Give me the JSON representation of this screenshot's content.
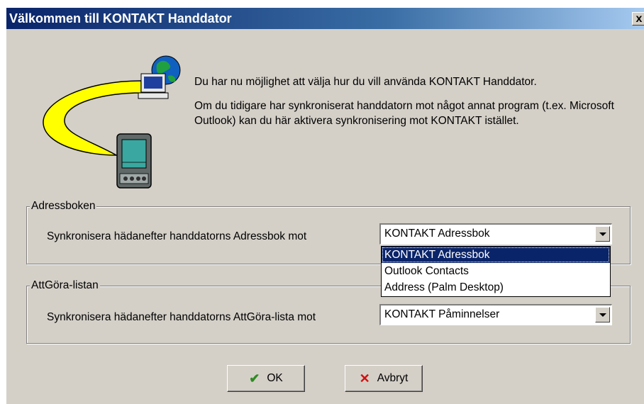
{
  "window": {
    "title": "Välkommen till KONTAKT Handdator",
    "close_label": "x"
  },
  "intro": {
    "line1": "Du har nu möjlighet att välja hur du vill använda KONTAKT Handdator.",
    "line2": "Om du tidigare har synkroniserat handdatorn mot något annat program (t.ex. Microsoft Outlook) kan du här aktivera synkronisering mot KONTAKT istället."
  },
  "address_group": {
    "legend": "Adressboken",
    "label": "Synkronisera hädanefter handdatorns Adressbok mot",
    "selected": "KONTAKT Adressbok",
    "dropdown_open": true,
    "options": [
      "KONTAKT Adressbok",
      "Outlook Contacts",
      "Address (Palm Desktop)"
    ],
    "highlighted_option": "KONTAKT Adressbok"
  },
  "todo_group": {
    "legend": "AttGöra-listan",
    "label": "Synkronisera hädanefter handdatorns AttGöra-lista mot",
    "selected": "KONTAKT Påminnelser"
  },
  "buttons": {
    "ok_label": "OK",
    "ok_icon": "checkmark-icon",
    "cancel_label": "Avbryt",
    "cancel_icon": "x-mark-icon"
  },
  "colors": {
    "dialog_face": "#d4d0c8",
    "titlebar_start": "#0a246a",
    "titlebar_end": "#a6caf0",
    "selection": "#0a246a",
    "ok_icon": "#2e8b20",
    "cancel_icon": "#d01010"
  }
}
